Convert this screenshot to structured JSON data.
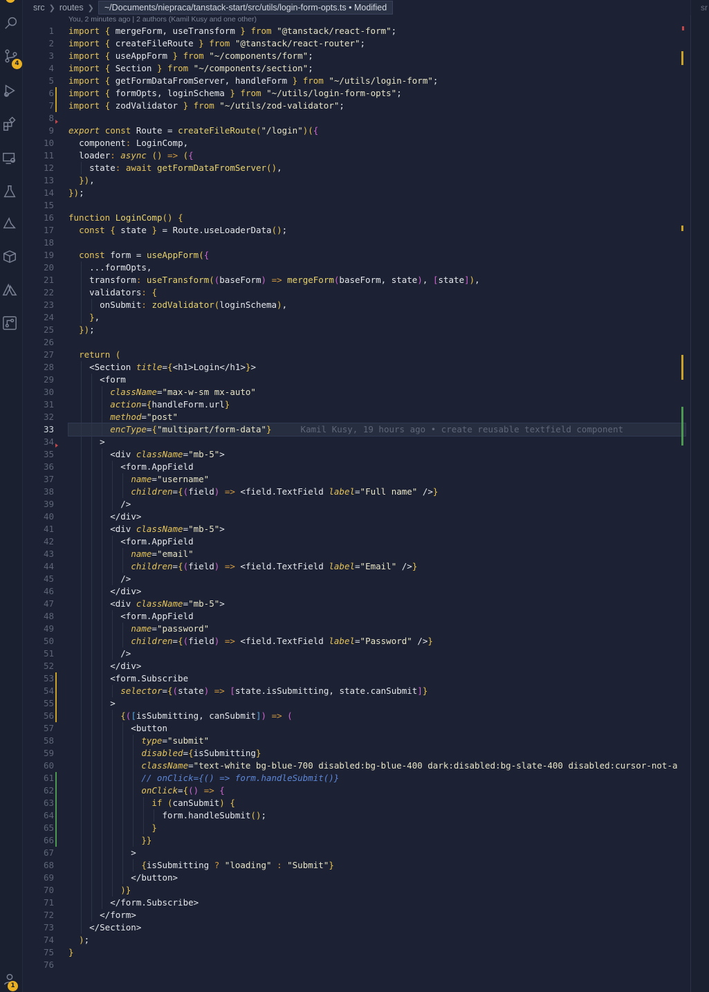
{
  "breadcrumb": {
    "items": [
      "src",
      "routes"
    ],
    "hover_path": "~/Documents/niepraca/tanstack-start/src/utils/login-form-opts.ts • Modified",
    "right_label": "sr"
  },
  "blame_header": "You, 2 minutes ago | 2 authors (Kamil Kusy and one other)",
  "activity_bar": {
    "icons": [
      "explorer-icon",
      "search-icon",
      "source-control-icon",
      "run-debug-icon",
      "extensions-icon",
      "remote-explorer-icon",
      "testing-icon",
      "azure-icon",
      "docker-icon",
      "azure-extension-icon",
      "git-graph-icon",
      "accounts-icon"
    ],
    "source_control_badge": "4",
    "accounts_badge": "1"
  },
  "editor": {
    "active_line": "33",
    "inline_blame": "Kamil Kusy, 19 hours ago • create reusable textfield component",
    "line_numbers": [
      "1",
      "2",
      "3",
      "4",
      "5",
      "6",
      "7",
      "8",
      "9",
      "10",
      "11",
      "12",
      "13",
      "14",
      "15",
      "16",
      "17",
      "18",
      "19",
      "20",
      "21",
      "22",
      "23",
      "24",
      "25",
      "26",
      "27",
      "28",
      "29",
      "30",
      "31",
      "32",
      "33",
      "34",
      "35",
      "36",
      "37",
      "38",
      "39",
      "40",
      "41",
      "42",
      "43",
      "44",
      "45",
      "46",
      "47",
      "48",
      "49",
      "50",
      "51",
      "52",
      "53",
      "54",
      "55",
      "56",
      "57",
      "58",
      "59",
      "60",
      "61",
      "62",
      "63",
      "64",
      "65",
      "66",
      "67",
      "68",
      "69",
      "70",
      "71",
      "72",
      "73",
      "74",
      "75",
      "76"
    ],
    "lines": [
      "import { mergeForm, useTransform } from \"@tanstack/react-form\";",
      "import { createFileRoute } from \"@tanstack/react-router\";",
      "import { useAppForm } from \"~/components/form\";",
      "import { Section } from \"~/components/section\";",
      "import { getFormDataFromServer, handleForm } from \"~/utils/login-form\";",
      "import { formOpts, loginSchema } from \"~/utils/login-form-opts\";",
      "import { zodValidator } from \"~/utils/zod-validator\";",
      "",
      "export const Route = createFileRoute(\"/login\")({",
      "  component: LoginComp,",
      "  loader: async () => ({",
      "    state: await getFormDataFromServer(),",
      "  }),",
      "});",
      "",
      "function LoginComp() {",
      "  const { state } = Route.useLoaderData();",
      "",
      "  const form = useAppForm({",
      "    ...formOpts,",
      "    transform: useTransform((baseForm) => mergeForm(baseForm, state), [state]),",
      "    validators: {",
      "      onSubmit: zodValidator(loginSchema),",
      "    },",
      "  });",
      "",
      "  return (",
      "    <Section title={<h1>Login</h1>}>",
      "      <form",
      "        className=\"max-w-sm mx-auto\"",
      "        action={handleForm.url}",
      "        method=\"post\"",
      "        encType={\"multipart/form-data\"}",
      "      >",
      "        <div className=\"mb-5\">",
      "          <form.AppField",
      "            name=\"username\"",
      "            children={(field) => <field.TextField label=\"Full name\" />}",
      "          />",
      "        </div>",
      "        <div className=\"mb-5\">",
      "          <form.AppField",
      "            name=\"email\"",
      "            children={(field) => <field.TextField label=\"Email\" />}",
      "          />",
      "        </div>",
      "        <div className=\"mb-5\">",
      "          <form.AppField",
      "            name=\"password\"",
      "            children={(field) => <field.TextField label=\"Password\" />}",
      "          />",
      "        </div>",
      "        <form.Subscribe",
      "          selector={(state) => [state.isSubmitting, state.canSubmit]}",
      "        >",
      "          {([isSubmitting, canSubmit]) => (",
      "            <button",
      "              type=\"submit\"",
      "              disabled={isSubmitting}",
      "              className=\"text-white bg-blue-700 disabled:bg-blue-400 dark:disabled:bg-slate-400 disabled:cursor-not-a",
      "              // onClick={() => form.handleSubmit()}",
      "              onClick={() => {",
      "                if (canSubmit) {",
      "                  form.handleSubmit();",
      "                }",
      "              }}",
      "            >",
      "              {isSubmitting ? \"loading\" : \"Submit\"}",
      "            </button>",
      "          )}",
      "        </form.Subscribe>",
      "      </form>",
      "    </Section>",
      "  );",
      "}",
      ""
    ]
  },
  "colors": {
    "background": "#1c2233",
    "modified_marker": "#c9a227",
    "added_marker": "#4c9a52",
    "deleted_marker": "#c0474b",
    "badge": "#e8b022"
  }
}
